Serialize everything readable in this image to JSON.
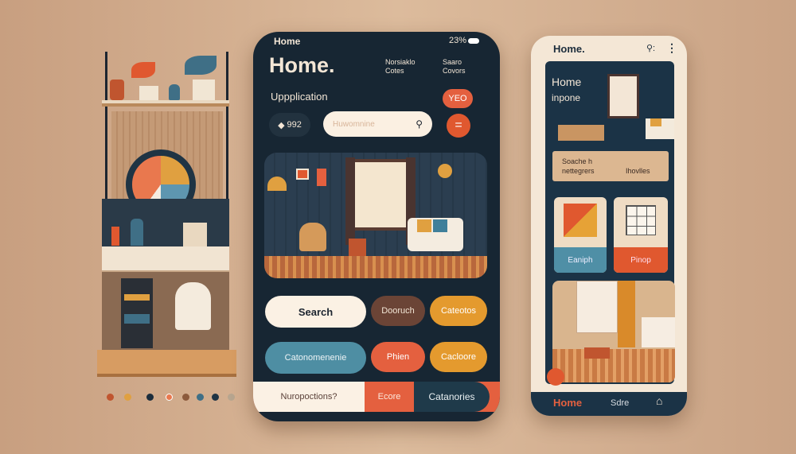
{
  "palette": [
    "#c0552f",
    "#e0a040",
    "#1c2d3c",
    "#e9784e",
    "#8c5a3c",
    "#3f6f86",
    "#1f3444",
    "#b7a58f"
  ],
  "main_phone": {
    "status_label": "Home",
    "battery": "23%",
    "title": "Home.",
    "nav": [
      "Norsiaklo Cotes",
      "Saaro Covors"
    ],
    "subtitle": "Uppplication",
    "badge": "YEO",
    "counter": "992",
    "search_placeholder": "Huwomnine",
    "buttons": [
      {
        "label": "Search",
        "color": "#fbf1e4"
      },
      {
        "label": "Dooruch",
        "color": "#6b4436"
      },
      {
        "label": "Cateotos",
        "color": "#e49a2e"
      },
      {
        "label": "Catonomenenie",
        "color": "#4e8ea3"
      },
      {
        "label": "Phien",
        "color": "#e4603f"
      },
      {
        "label": "Cacloore",
        "color": "#e49a2e"
      }
    ],
    "bottom_bar": [
      "Nuropoctions?",
      "Ecore",
      "Catanories"
    ]
  },
  "side_phone": {
    "title": "Home.",
    "hero_title": "Home",
    "hero_subtitle": "inpone",
    "search_line1": "Soache h",
    "search_line2": "nettegrers",
    "search_right": "Ihovlles",
    "cards": [
      {
        "label": "Eaniph",
        "color": "#4f8fa6"
      },
      {
        "label": "Pinop",
        "color": "#e0582f"
      }
    ],
    "tabs": [
      "Home",
      "Sdre"
    ]
  }
}
